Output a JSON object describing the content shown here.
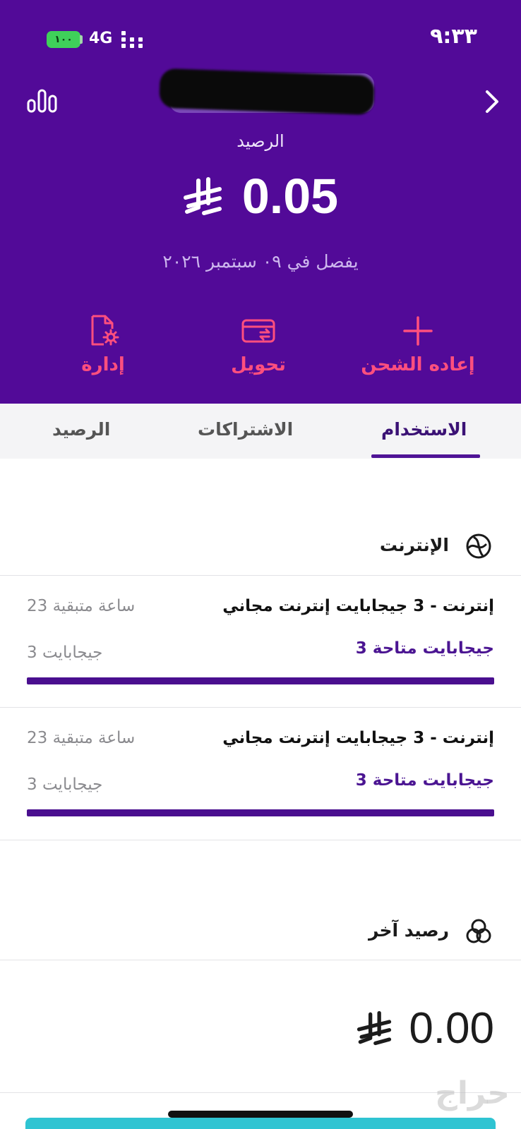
{
  "status_bar": {
    "time": "٩:٣٣",
    "battery": "١٠٠",
    "network": "4G"
  },
  "header": {
    "balance_label": "الرصيد",
    "balance_amount": "0.05",
    "expiry_text": "يفصل في ٠٩ سبتمبر ٢٠٢٦",
    "actions": [
      {
        "label": "إدارة",
        "icon": "file-gear-icon"
      },
      {
        "label": "تحويل",
        "icon": "card-transfer-icon"
      },
      {
        "label": "إعاده الشحن",
        "icon": "plus-icon"
      }
    ]
  },
  "tabs": [
    {
      "label": "الرصيد",
      "active": false
    },
    {
      "label": "الاشتراكات",
      "active": false
    },
    {
      "label": "الاستخدام",
      "active": true
    }
  ],
  "internet_section": {
    "title": "الإنترنت",
    "icon": "globe-icon",
    "bundles": [
      {
        "title": "إنترنت - 3 جيجابايت إنترنت مجاني",
        "available": "3 جيجابايت متاحة",
        "time_left": "23 ساعة متبقية",
        "total": "3 جيجابايت",
        "remaining_fraction": 1.0
      },
      {
        "title": "إنترنت - 3 جيجابايت إنترنت مجاني",
        "available": "3 جيجابايت متاحة",
        "time_left": "23 ساعة متبقية",
        "total": "3 جيجابايت",
        "remaining_fraction": 1.0
      }
    ]
  },
  "other_section": {
    "title": "رصيد آخر",
    "icon": "coins-icon",
    "amount": "0.00"
  },
  "colors": {
    "header_bg": "#520a98",
    "accent": "#ff4f7e",
    "progress": "#4a0f8f",
    "bottom_button": "#2fc4d2"
  },
  "watermark": "حراج"
}
